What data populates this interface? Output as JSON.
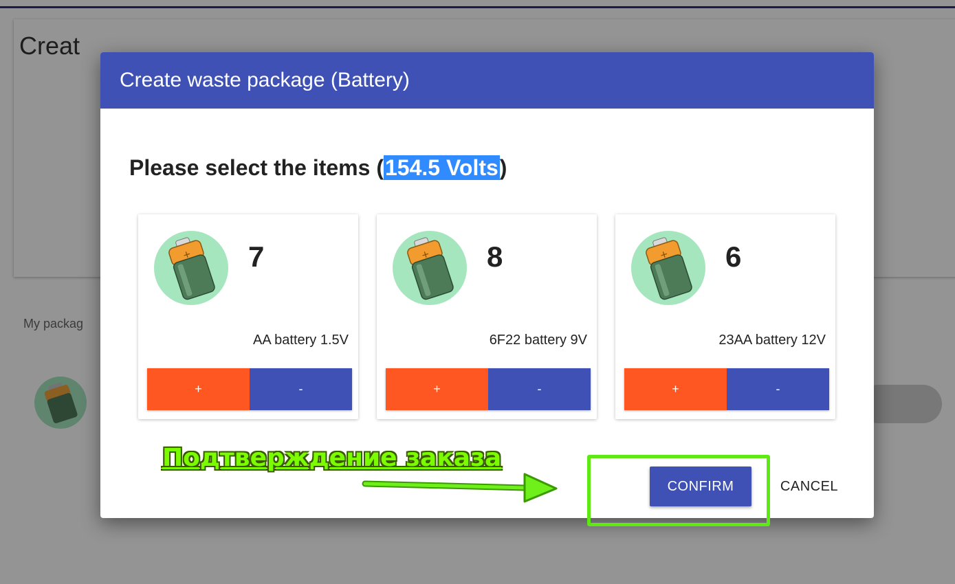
{
  "background": {
    "title_partial": "Creat",
    "section_label_partial": "My packag"
  },
  "dialog": {
    "title": "Create waste package (Battery)",
    "prompt_prefix": "Please select the items (",
    "prompt_value": "154.5 Volts",
    "prompt_suffix": ")",
    "items": [
      {
        "count": "7",
        "name": "AA battery 1.5V",
        "plus": "+",
        "minus": "-",
        "icon": "battery-icon"
      },
      {
        "count": "8",
        "name": "6F22 battery 9V",
        "plus": "+",
        "minus": "-",
        "icon": "battery-icon"
      },
      {
        "count": "6",
        "name": "23AA battery 12V",
        "plus": "+",
        "minus": "-",
        "icon": "battery-icon"
      }
    ],
    "confirm_label": "CONFIRM",
    "cancel_label": "CANCEL"
  },
  "annotation": {
    "text": "Подтверждение заказа"
  },
  "colors": {
    "primary": "#3f51b5",
    "accent": "#ff5722",
    "avatar_bg": "#a5e6bf",
    "annotation": "#5ee814"
  }
}
